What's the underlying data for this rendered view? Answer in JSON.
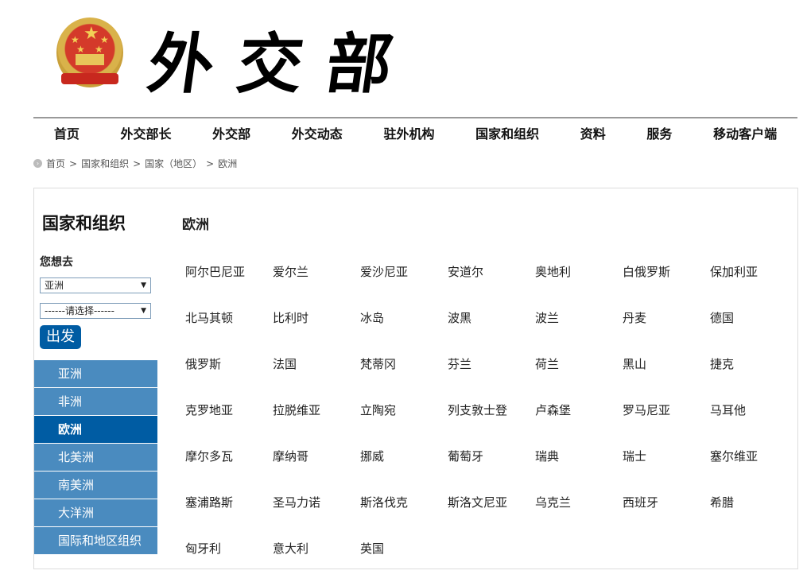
{
  "header": {
    "logo_text": "外交部"
  },
  "nav": [
    "首页",
    "外交部长",
    "外交部",
    "外交动态",
    "驻外机构",
    "国家和组织",
    "资料",
    "服务",
    "移动客户端"
  ],
  "breadcrumb": [
    "首页",
    "国家和组织",
    "国家（地区）",
    "欧洲"
  ],
  "sidebar": {
    "title": "国家和组织",
    "where_label": "您想去",
    "continent_select": "亚洲",
    "country_select": "------请选择------",
    "go_button": "出发",
    "regions": [
      "亚洲",
      "非洲",
      "欧洲",
      "北美洲",
      "南美洲",
      "大洋洲",
      "国际和地区组织"
    ],
    "active_region": "欧洲"
  },
  "content": {
    "title": "欧洲",
    "countries": [
      "阿尔巴尼亚",
      "爱尔兰",
      "爱沙尼亚",
      "安道尔",
      "奥地利",
      "白俄罗斯",
      "保加利亚",
      "北马其顿",
      "比利时",
      "冰岛",
      "波黑",
      "波兰",
      "丹麦",
      "德国",
      "俄罗斯",
      "法国",
      "梵蒂冈",
      "芬兰",
      "荷兰",
      "黑山",
      "捷克",
      "克罗地亚",
      "拉脱维亚",
      "立陶宛",
      "列支敦士登",
      "卢森堡",
      "罗马尼亚",
      "马耳他",
      "摩尔多瓦",
      "摩纳哥",
      "挪威",
      "葡萄牙",
      "瑞典",
      "瑞士",
      "塞尔维亚",
      "塞浦路斯",
      "圣马力诺",
      "斯洛伐克",
      "斯洛文尼亚",
      "乌克兰",
      "西班牙",
      "希腊",
      "匈牙利",
      "意大利",
      "英国"
    ]
  },
  "colors": {
    "region_bg": "#4a8bbf",
    "region_active": "#005ca3"
  }
}
